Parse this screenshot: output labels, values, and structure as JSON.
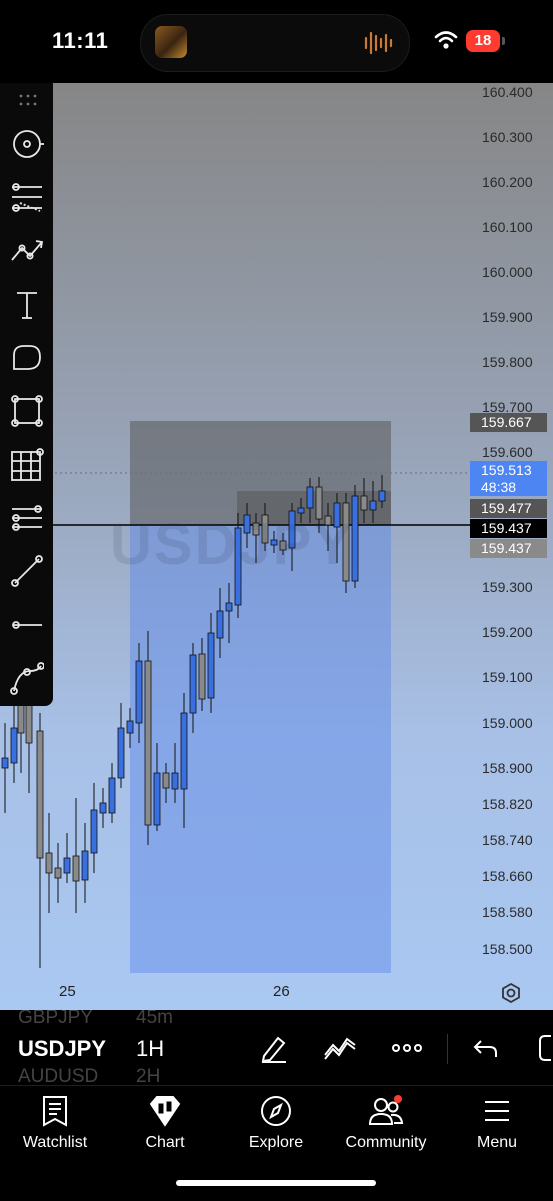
{
  "status_bar": {
    "time": "11:11",
    "battery": "18",
    "battery_color": "#ff3b30"
  },
  "chart": {
    "symbol_watermark": "USDJPY",
    "price_scale": [
      "160.400",
      "160.300",
      "160.200",
      "160.100",
      "160.000",
      "159.900",
      "159.800",
      "159.700",
      "159.600",
      "159.300",
      "159.200",
      "159.100",
      "159.000",
      "158.900",
      "158.820",
      "158.740",
      "158.660",
      "158.580",
      "158.500"
    ],
    "tags": {
      "target": "159.667",
      "last_price": "159.513",
      "countdown": "48:38",
      "tag_477": "159.477",
      "entry": "159.437",
      "entry_grey": "159.437"
    },
    "dates": [
      "25",
      "26"
    ],
    "colors": {
      "up": "#3a6fe0",
      "down": "#8a8a8a",
      "last_price": "#4d86f2",
      "entry_line": "#000000"
    }
  },
  "toolbar": {
    "tools": [
      "cursor-icon",
      "fib-retracement-icon",
      "trend-line-icon",
      "text-icon",
      "shape-icon",
      "rectangle-icon",
      "grid-icon",
      "fib-channel-icon",
      "ray-icon",
      "horizontal-line-icon",
      "curve-icon"
    ]
  },
  "symbol_bar": {
    "ghost_above": {
      "symbol": "GBPJPY",
      "interval": "45m"
    },
    "symbol": "USDJPY",
    "interval": "1H",
    "ghost_below": {
      "symbol": "AUDUSD",
      "interval": "2H"
    }
  },
  "nav": [
    {
      "label": "Watchlist",
      "icon": "watchlist-icon"
    },
    {
      "label": "Chart",
      "icon": "chart-icon"
    },
    {
      "label": "Explore",
      "icon": "compass-icon"
    },
    {
      "label": "Community",
      "icon": "community-icon"
    },
    {
      "label": "Menu",
      "icon": "menu-icon"
    }
  ]
}
